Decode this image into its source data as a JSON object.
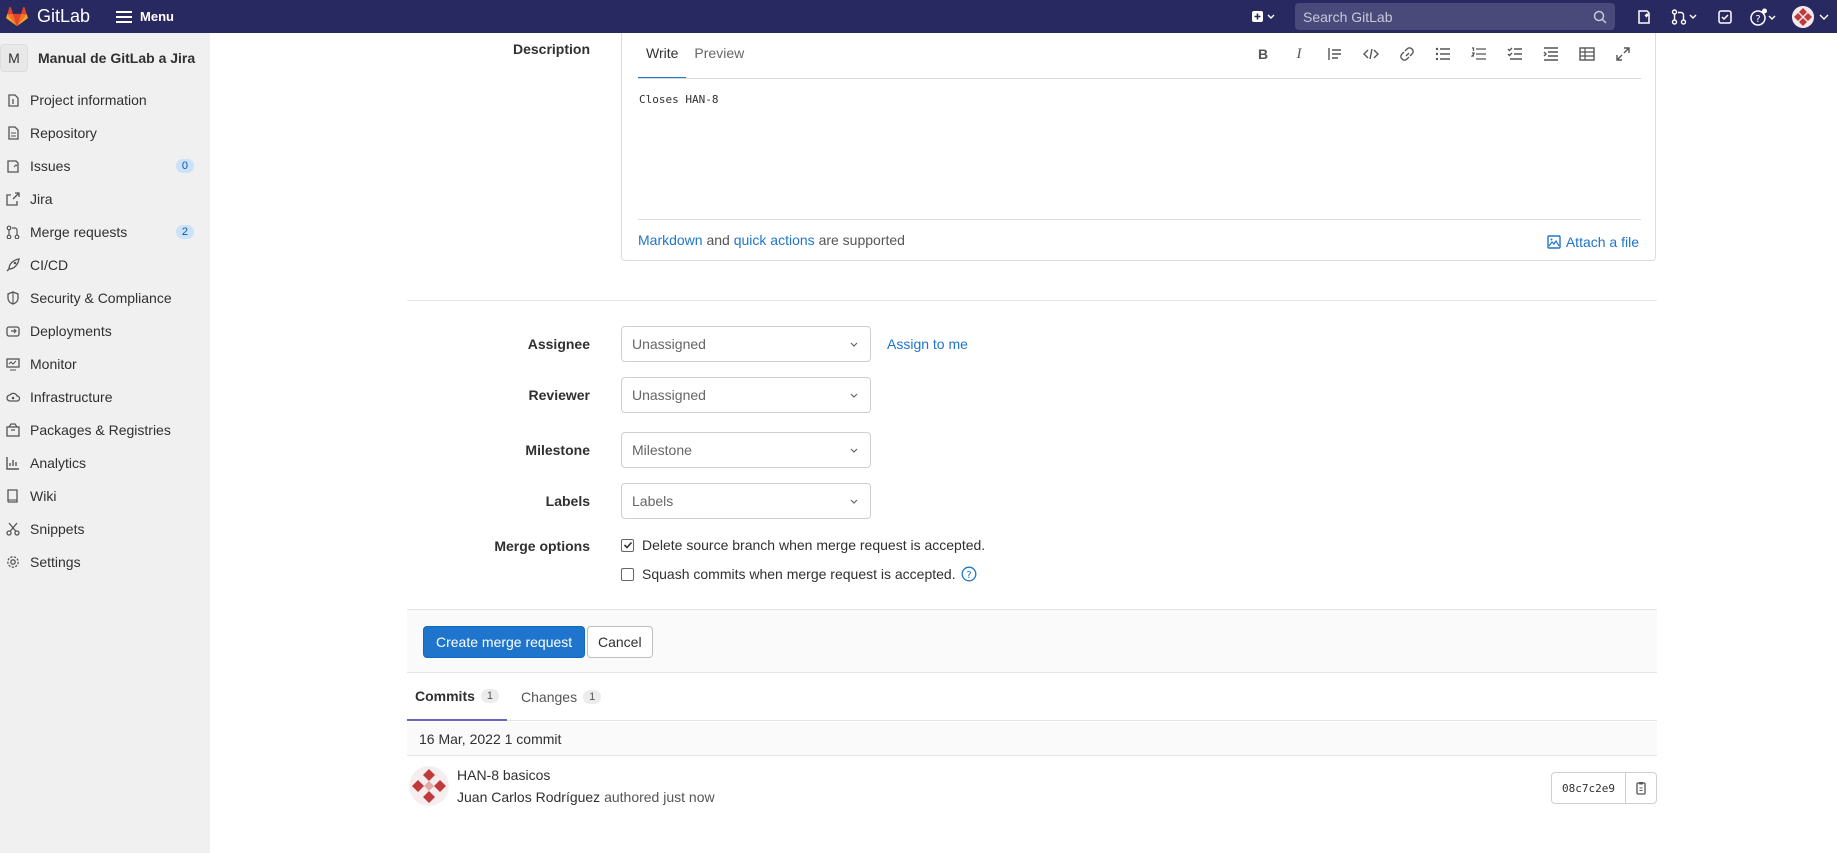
{
  "topbar": {
    "brand": "GitLab",
    "menu_label": "Menu",
    "search_placeholder": "Search GitLab"
  },
  "sidebar": {
    "project_initial": "M",
    "project_name": "Manual de GitLab a Jira",
    "items": [
      {
        "label": "Project information",
        "icon": "info-icon"
      },
      {
        "label": "Repository",
        "icon": "doc-icon"
      },
      {
        "label": "Issues",
        "icon": "issues-icon",
        "badge": "0"
      },
      {
        "label": "Jira",
        "icon": "external-link-icon"
      },
      {
        "label": "Merge requests",
        "icon": "merge-request-icon",
        "badge": "2"
      },
      {
        "label": "CI/CD",
        "icon": "rocket-icon"
      },
      {
        "label": "Security & Compliance",
        "icon": "shield-icon"
      },
      {
        "label": "Deployments",
        "icon": "deployments-icon"
      },
      {
        "label": "Monitor",
        "icon": "monitor-icon"
      },
      {
        "label": "Infrastructure",
        "icon": "cloud-icon"
      },
      {
        "label": "Packages & Registries",
        "icon": "package-icon"
      },
      {
        "label": "Analytics",
        "icon": "chart-icon"
      },
      {
        "label": "Wiki",
        "icon": "book-icon"
      },
      {
        "label": "Snippets",
        "icon": "scissors-icon"
      },
      {
        "label": "Settings",
        "icon": "gear-icon"
      }
    ]
  },
  "form": {
    "description_label": "Description",
    "editor": {
      "tab_write": "Write",
      "tab_preview": "Preview",
      "text": "Closes HAN-8",
      "footer_markdown": "Markdown",
      "footer_and": "and",
      "footer_quick_actions": "quick actions",
      "footer_supported": "are supported",
      "attach_label": "Attach a file"
    },
    "assignee_label": "Assignee",
    "assignee_value": "Unassigned",
    "assign_to_me": "Assign to me",
    "reviewer_label": "Reviewer",
    "reviewer_value": "Unassigned",
    "milestone_label": "Milestone",
    "milestone_value": "Milestone",
    "labels_label": "Labels",
    "labels_value": "Labels",
    "merge_options_label": "Merge options",
    "delete_branch_label": "Delete source branch when merge request is accepted.",
    "delete_branch_checked": true,
    "squash_label": "Squash commits when merge request is accepted.",
    "squash_checked": false
  },
  "actions": {
    "create_label": "Create merge request",
    "cancel_label": "Cancel"
  },
  "tabs": [
    {
      "label": "Commits",
      "count": "1",
      "active": true
    },
    {
      "label": "Changes",
      "count": "1",
      "active": false
    }
  ],
  "commits": {
    "day_header": "16 Mar, 2022 1 commit",
    "items": [
      {
        "title": "HAN-8 basicos",
        "author": "Juan Carlos Rodríguez",
        "meta": "authored just now",
        "sha": "08c7c2e9"
      }
    ]
  },
  "colors": {
    "topbar": "#292961",
    "primary": "#1f75cb",
    "sidebar_bg": "#f0f0f0"
  }
}
